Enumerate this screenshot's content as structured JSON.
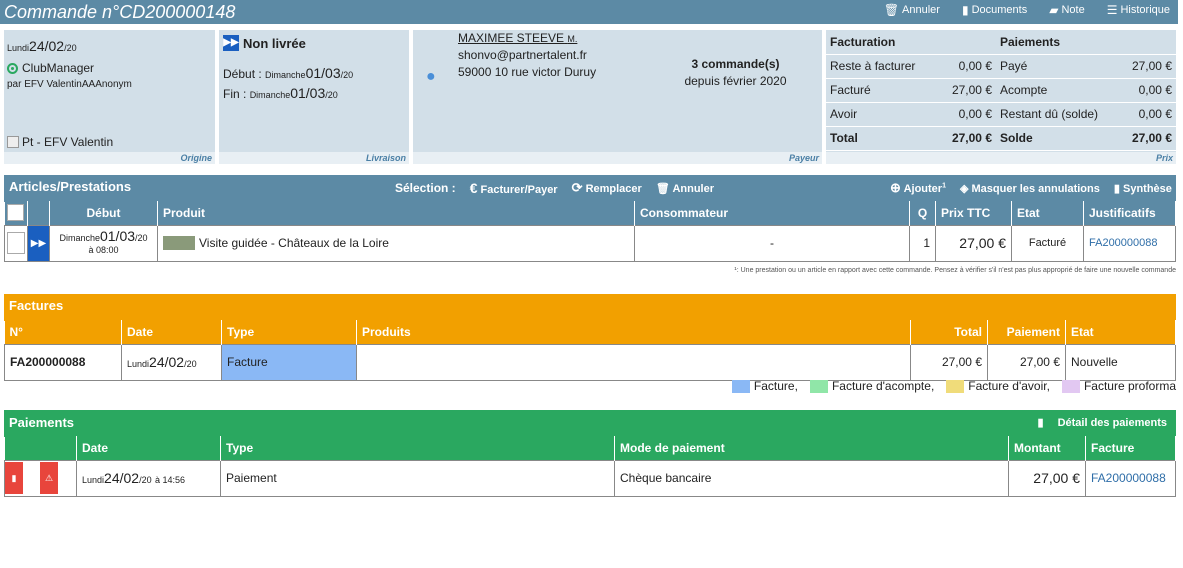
{
  "header": {
    "title": "Commande n°CD200000148",
    "actions": {
      "annuler": "Annuler",
      "documents": "Documents",
      "note": "Note",
      "historique": "Historique"
    }
  },
  "origine": {
    "day_name": "Lundi",
    "date": "24/02",
    "year": "/20",
    "club": "ClubManager",
    "by": "par EFV ValentinAAAnonym",
    "image_alt": "Pt - EFV Valentin",
    "tag": "Origine"
  },
  "livraison": {
    "status": "Non livrée",
    "debut_label": "Début :",
    "debut_day": "Dimanche",
    "debut_date": "01/03",
    "debut_year": "/20",
    "fin_label": "Fin :",
    "fin_day": "Dimanche",
    "fin_date": "01/03",
    "fin_year": "/20",
    "tag": "Livraison"
  },
  "payeur": {
    "name": "MAXIMEE STEEVE",
    "civility": "M.",
    "email": "shonvo@partnertalent.fr",
    "address": "59000 10 rue victor Duruy",
    "orders": "3 commande(s)",
    "since": "depuis février 2020",
    "tag": "Payeur"
  },
  "prix": {
    "facturation_header": "Facturation",
    "paiements_header": "Paiements",
    "rows": [
      {
        "l1": "Reste à facturer",
        "v1": "0,00 €",
        "l2": "Payé",
        "v2": "27,00 €"
      },
      {
        "l1": "Facturé",
        "v1": "27,00 €",
        "l2": "Acompte",
        "v2": "0,00 €"
      },
      {
        "l1": "Avoir",
        "v1": "0,00 €",
        "l2": "Restant dû (solde)",
        "v2": "0,00 €"
      },
      {
        "l1": "Total",
        "v1": "27,00 €",
        "l2": "Solde",
        "v2": "27,00 €"
      }
    ],
    "tag": "Prix"
  },
  "articles": {
    "title": "Articles/Prestations",
    "selection_label": "Sélection :",
    "btn_facturer": "Facturer/Payer",
    "btn_remplacer": "Remplacer",
    "btn_annuler": "Annuler",
    "btn_ajouter": "Ajouter",
    "ajouter_sup": "1",
    "btn_masquer": "Masquer les annulations",
    "btn_synthese": "Synthèse",
    "columns": {
      "debut": "Début",
      "produit": "Produit",
      "consommateur": "Consommateur",
      "q": "Q",
      "prix": "Prix TTC",
      "etat": "Etat",
      "justif": "Justificatifs"
    },
    "row": {
      "day": "Dimanche",
      "date": "01/03",
      "year": "/20",
      "time": "à 08:00",
      "produit": "Visite guidée - Châteaux de la Loire",
      "consommateur": "-",
      "q": "1",
      "prix": "27,00 €",
      "etat": "Facturé",
      "justif": "FA200000088"
    },
    "footnote": "¹: Une prestation ou un article en rapport avec cette commande. Pensez à vérifier s'il n'est pas plus approprié de faire une nouvelle commande"
  },
  "factures": {
    "title": "Factures",
    "columns": {
      "num": "N°",
      "date": "Date",
      "type": "Type",
      "produits": "Produits",
      "total": "Total",
      "paiement": "Paiement",
      "etat": "Etat"
    },
    "row": {
      "num": "FA200000088",
      "day": "Lundi",
      "date": "24/02",
      "year": "/20",
      "type": "Facture",
      "produits": "",
      "total": "27,00 €",
      "paiement": "27,00 €",
      "etat": "Nouvelle"
    },
    "legend": [
      {
        "label": "Facture,",
        "color": "#8ab8f5"
      },
      {
        "label": "Facture d'acompte,",
        "color": "#90e6a8"
      },
      {
        "label": "Facture d'avoir,",
        "color": "#f0dc7a"
      },
      {
        "label": "Facture proforma",
        "color": "#e2c8f2"
      }
    ]
  },
  "paiements": {
    "title": "Paiements",
    "btn_detail": "Détail des paiements",
    "columns": {
      "date": "Date",
      "type": "Type",
      "mode": "Mode de paiement",
      "montant": "Montant",
      "facture": "Facture"
    },
    "row": {
      "day": "Lundi",
      "date": "24/02",
      "year": "/20",
      "time": "à 14:56",
      "type": "Paiement",
      "mode": "Chèque bancaire",
      "montant": "27,00 €",
      "facture": "FA200000088"
    }
  },
  "colors": {
    "blue_header": "#5c8aa5",
    "orange": "#f2a000",
    "green": "#2aa860",
    "panel": "#d2dfe8"
  }
}
